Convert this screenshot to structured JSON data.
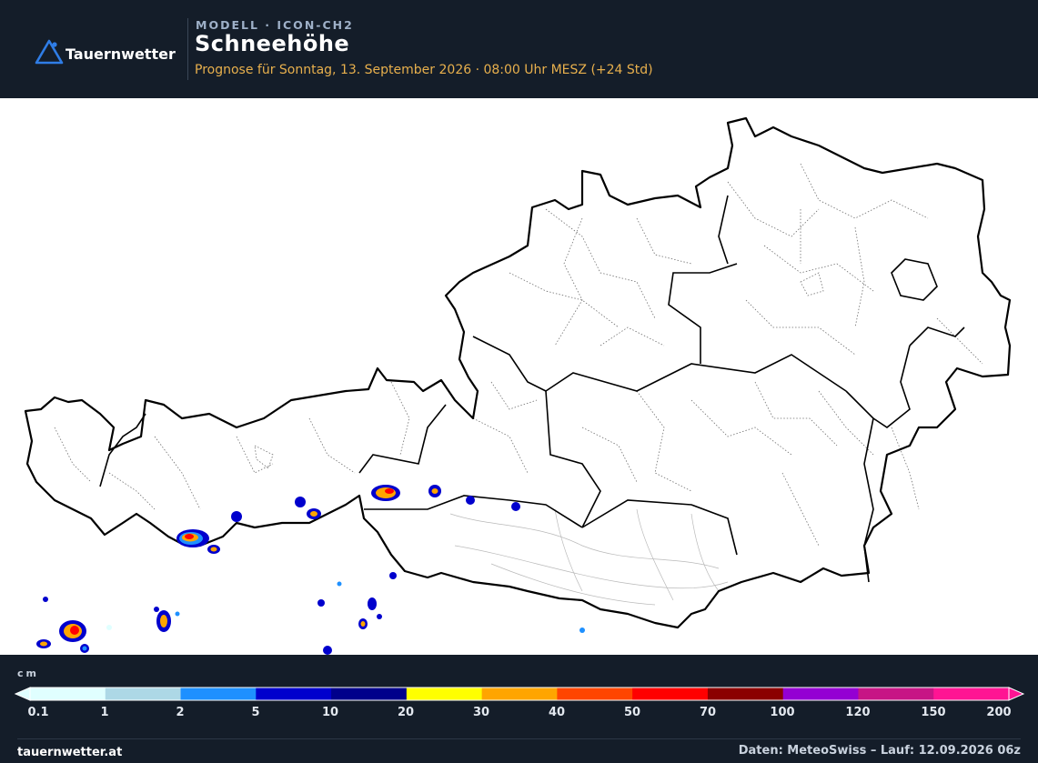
{
  "header": {
    "brand": "Tauernwetter",
    "model": "MODELL · ICON-CH2",
    "title": "Schneehöhe",
    "subtitle": "Prognose für Sonntag, 13. September 2026 · 08:00 Uhr MESZ  (+24 Std)"
  },
  "map": {
    "region": "Austria",
    "snow_cells": [
      {
        "color": "#ff0000",
        "level": "50-70"
      },
      {
        "color": "#ffa500",
        "level": "30-40"
      },
      {
        "color": "#0000cd",
        "level": "5-10"
      },
      {
        "color": "#1e90ff",
        "level": "2-5"
      }
    ]
  },
  "legend": {
    "unit": "cm",
    "colors": [
      "#e0ffff",
      "#add8e6",
      "#1e90ff",
      "#0000cd",
      "#00008b",
      "#ffff00",
      "#ffa500",
      "#ff4500",
      "#ff0000",
      "#8b0000",
      "#9400d3",
      "#c71585",
      "#ff1493"
    ],
    "ticks": [
      "0.1",
      "1",
      "2",
      "5",
      "10",
      "20",
      "30",
      "40",
      "50",
      "70",
      "100",
      "120",
      "150",
      "200"
    ]
  },
  "footer": {
    "site": "tauernwetter.at",
    "source": "Daten: MeteoSwiss – Lauf: 12.09.2026 06z"
  }
}
